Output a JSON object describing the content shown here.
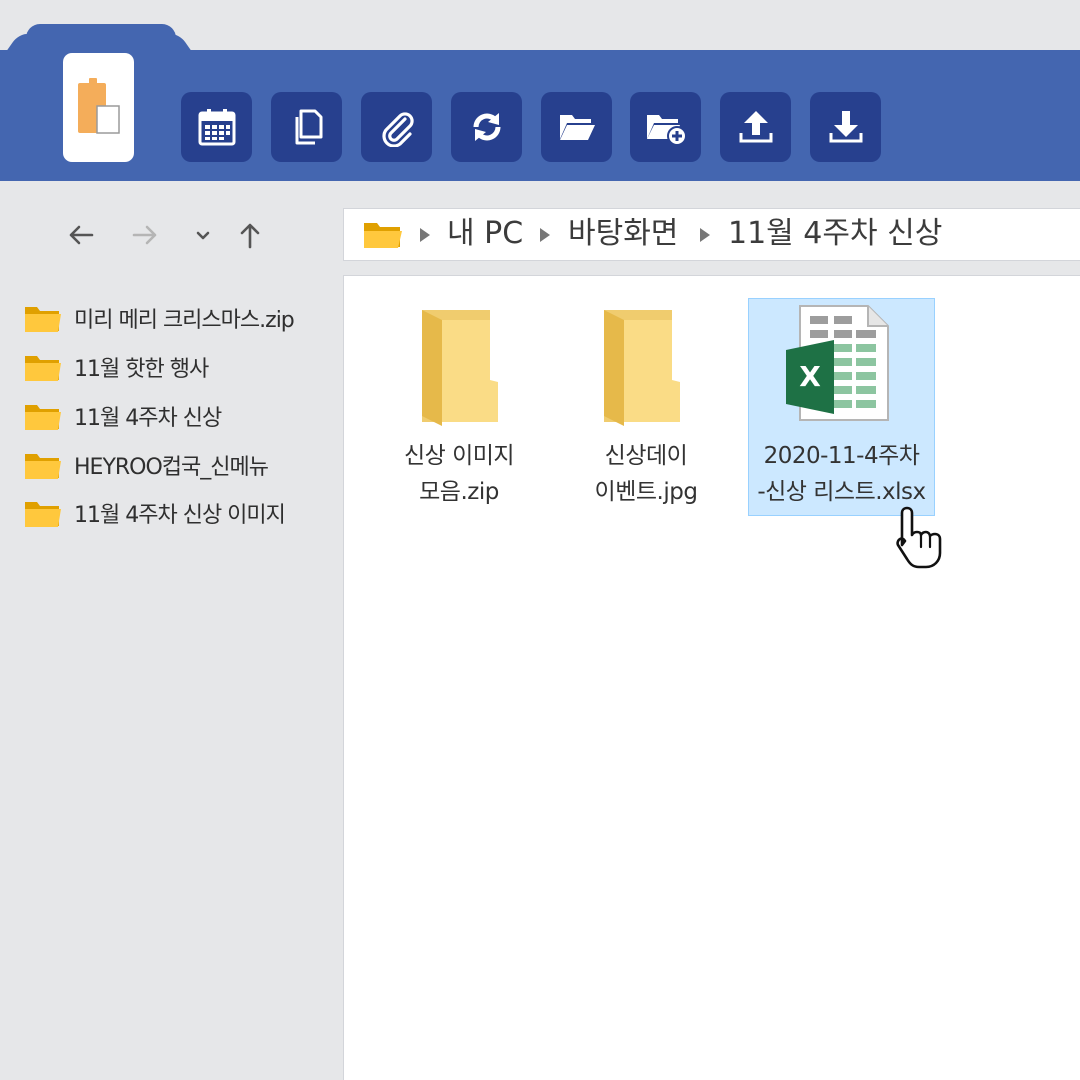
{
  "toolbar": {
    "buttons": [
      {
        "icon": "calendar-icon"
      },
      {
        "icon": "copy-icon"
      },
      {
        "icon": "paperclip-icon"
      },
      {
        "icon": "sync-icon"
      },
      {
        "icon": "folder-open-icon"
      },
      {
        "icon": "new-folder-icon"
      },
      {
        "icon": "upload-icon"
      },
      {
        "icon": "download-icon"
      }
    ],
    "app_icon": "clipboard-paste-icon"
  },
  "nav": {
    "back_icon": "arrow-left-icon",
    "forward_icon": "arrow-right-icon",
    "recent_icon": "chevron-down-icon",
    "up_icon": "arrow-up-icon"
  },
  "address": {
    "crumbs": [
      "내 PC",
      "바탕화면",
      "11월 4주차 신상"
    ]
  },
  "sidebar": {
    "items": [
      {
        "label": "미리 메리 크리스마스.zip"
      },
      {
        "label": "11월 핫한 행사"
      },
      {
        "label": "11월 4주차 신상"
      },
      {
        "label": "HEYROO컵국_신메뉴"
      },
      {
        "label": "11월 4주차 신상 이미지"
      }
    ]
  },
  "files": [
    {
      "type": "folder",
      "line1": "신상 이미지",
      "line2": "모음.zip",
      "selected": false
    },
    {
      "type": "folder",
      "line1": "신상데이",
      "line2": "이벤트.jpg",
      "selected": false
    },
    {
      "type": "excel",
      "line1": "2020-11-4주차",
      "line2": "-신상 리스트.xlsx",
      "selected": true
    }
  ],
  "colors": {
    "ribbon": "#4466b0",
    "button": "#27408e",
    "folder": "#f8c33a",
    "selection": "#cce8ff",
    "excel_green": "#1e7145"
  }
}
